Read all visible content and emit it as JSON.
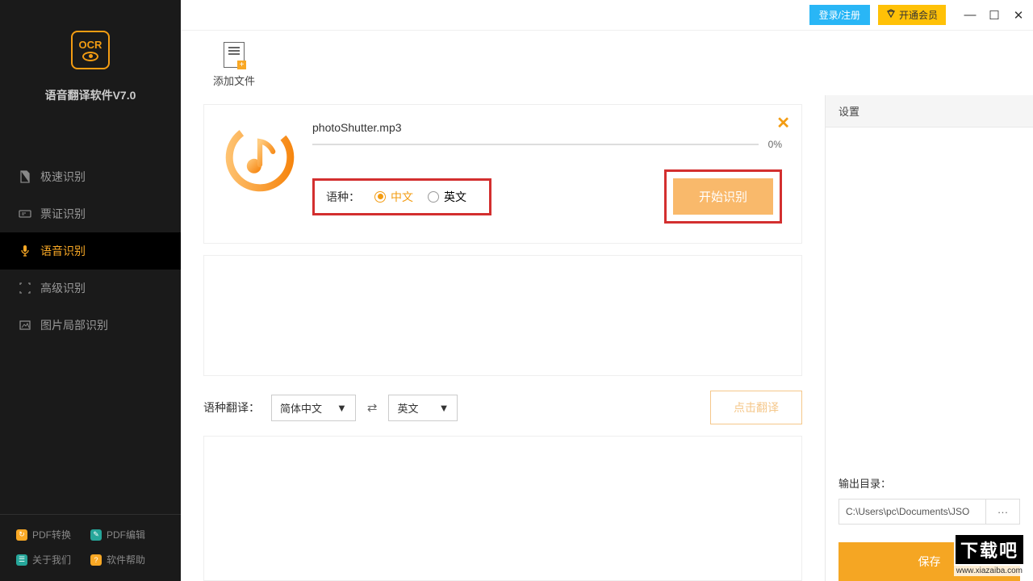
{
  "app": {
    "title": "语音翻译软件V7.0",
    "logo_label": "OCR"
  },
  "titlebar": {
    "login": "登录/注册",
    "vip": "开通会员"
  },
  "nav": {
    "items": [
      {
        "label": "极速识别"
      },
      {
        "label": "票证识别"
      },
      {
        "label": "语音识别"
      },
      {
        "label": "高级识别"
      },
      {
        "label": "图片局部识别"
      }
    ]
  },
  "bottom_links": {
    "pdf_convert": "PDF转换",
    "pdf_edit": "PDF编辑",
    "about": "关于我们",
    "help": "软件帮助"
  },
  "toolbar": {
    "add_file": "添加文件"
  },
  "file": {
    "name": "photoShutter.mp3",
    "progress_pct": "0%",
    "lang_label": "语种：",
    "opt_cn": "中文",
    "opt_en": "英文",
    "start": "开始识别"
  },
  "translate": {
    "label": "语种翻译：",
    "from": "简体中文",
    "to": "英文",
    "button": "点击翻译"
  },
  "right": {
    "settings": "设置",
    "out_label": "输出目录：",
    "out_path": "C:\\Users\\pc\\Documents\\JSO",
    "browse": "···",
    "save": "保存"
  },
  "watermark": {
    "brand": "下载吧",
    "url": "www.xiazaiba.com"
  },
  "colors": {
    "accent": "#f5a623",
    "highlight_border": "#d32f2f"
  }
}
